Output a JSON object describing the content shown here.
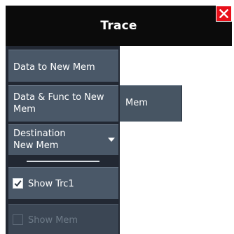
{
  "dialog": {
    "title": "Trace",
    "close_icon": "close-icon",
    "colors": {
      "title_bg": "#0b0b0b",
      "close_bg": "#e8101a",
      "button_bg": "#4a5868",
      "sidebar_bg": "#222833"
    }
  },
  "menu": {
    "data_to_new_mem": "Data to New Mem",
    "data_func_to_new_mem": "Data & Func to New Mem",
    "destination_label": "Destination",
    "destination_value": "New Mem",
    "show_trc1": {
      "label": "Show Trc1",
      "checked": true
    },
    "show_mem": {
      "label": "Show Mem",
      "checked": false,
      "disabled": true
    }
  },
  "submenu": {
    "item": "Mem"
  }
}
